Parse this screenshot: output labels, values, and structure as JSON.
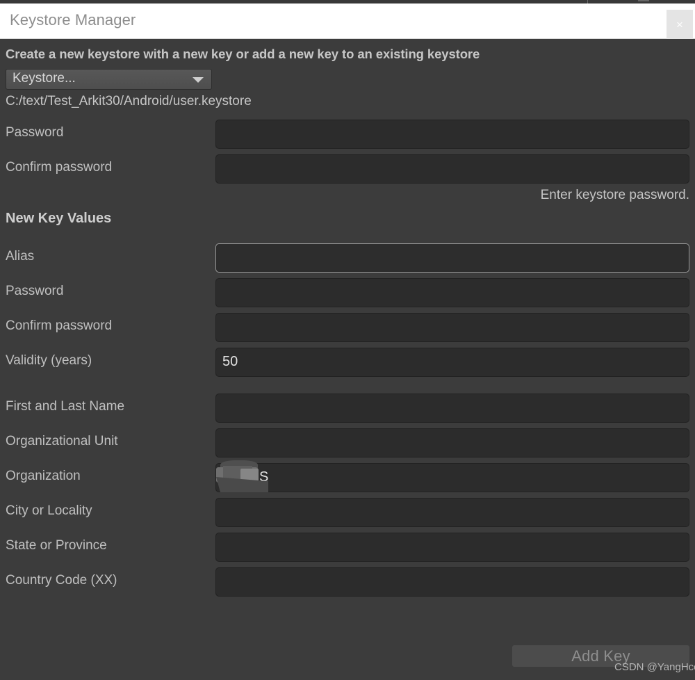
{
  "window": {
    "title": "Keystore Manager",
    "close_icon": "close-icon",
    "close_label": "×"
  },
  "dialog": {
    "heading": "Create a new keystore with a new key or add a new key to an existing keystore",
    "keystore_dropdown": {
      "label": "Keystore...",
      "arrow_icon": "chevron-down-icon"
    },
    "keystore_path": "C:/text/Test_Arkit30/Android/user.keystore",
    "keystore_fields": [
      {
        "label": "Password",
        "value": "",
        "placeholder": ""
      },
      {
        "label": "Confirm password",
        "value": "",
        "placeholder": ""
      }
    ],
    "keystore_hint": "Enter keystore password.",
    "new_key_section": {
      "title": "New Key Values",
      "fields": [
        {
          "label": "Alias",
          "value": "",
          "placeholder": "",
          "focused": true
        },
        {
          "label": "Password",
          "value": "",
          "placeholder": "",
          "focused": false
        },
        {
          "label": "Confirm password",
          "value": "",
          "placeholder": "",
          "focused": false
        },
        {
          "label": "Validity (years)",
          "value": "50",
          "placeholder": "",
          "focused": false
        },
        {
          "label": "First and Last Name",
          "value": "",
          "placeholder": "",
          "focused": false
        },
        {
          "label": "Organizational Unit",
          "value": "",
          "placeholder": "",
          "focused": false
        },
        {
          "label": "Organization",
          "value": "S",
          "placeholder": "",
          "focused": false,
          "redacted": true
        },
        {
          "label": "City or Locality",
          "value": "",
          "placeholder": "",
          "focused": false
        },
        {
          "label": "State or Province",
          "value": "",
          "placeholder": "",
          "focused": false
        },
        {
          "label": "Country Code (XX)",
          "value": "",
          "placeholder": "",
          "focused": false
        }
      ]
    },
    "add_key_button": "Add Key"
  },
  "watermark": "CSDN @YangHcc",
  "colors": {
    "dialog_background": "#3c3c3c",
    "titlebar_background": "#ffffff",
    "titlebar_text": "#8d8d8d",
    "field_background": "#2c2c2c",
    "field_border": "#222222",
    "field_border_focused": "#9a9a9a",
    "label_text": "#c0c0c0",
    "button_background": "#4c4c4c",
    "button_text_disabled": "#8e8e8e"
  }
}
